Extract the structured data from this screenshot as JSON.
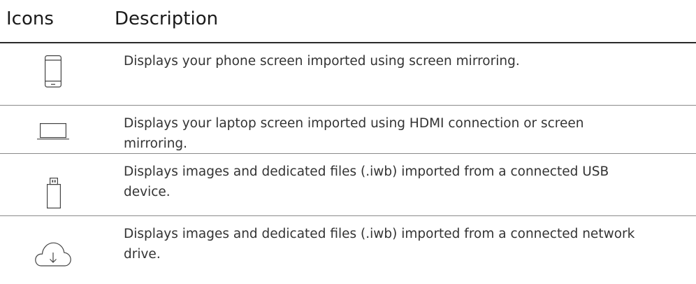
{
  "table": {
    "headers": {
      "icons": "Icons",
      "description": "Description"
    },
    "rows": [
      {
        "icon": "phone-icon",
        "description": "Displays your phone screen imported using screen mirroring."
      },
      {
        "icon": "laptop-icon",
        "description": "Displays your laptop screen imported using HDMI connection or screen\nmirroring."
      },
      {
        "icon": "usb-drive-icon",
        "description": "Displays images and dedicated files (.iwb) imported from a connected USB\ndevice."
      },
      {
        "icon": "cloud-download-icon",
        "description": "Displays images and dedicated files (.iwb) imported from a connected network\ndrive."
      }
    ]
  }
}
